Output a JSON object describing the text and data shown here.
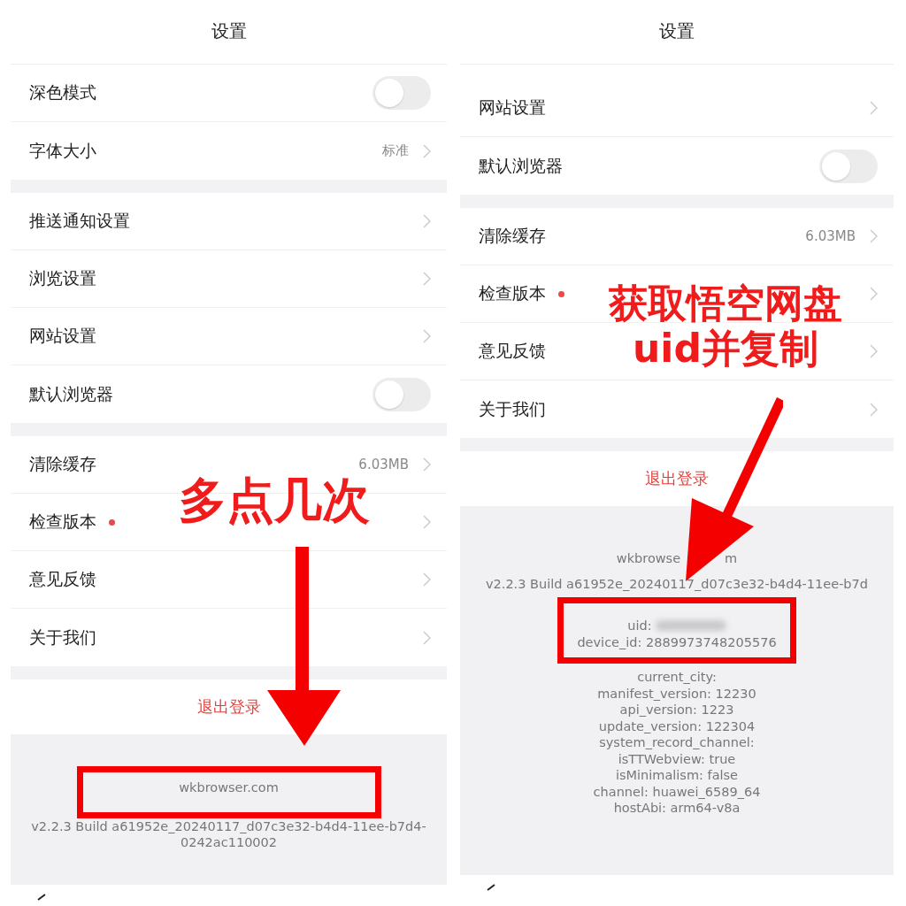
{
  "panels": [
    {
      "title": "设置",
      "groups": [
        [
          {
            "label": "深色模式",
            "kind": "toggle",
            "on": false
          },
          {
            "label": "字体大小",
            "kind": "link",
            "value": "标准"
          }
        ],
        [
          {
            "label": "推送通知设置",
            "kind": "link"
          },
          {
            "label": "浏览设置",
            "kind": "link"
          },
          {
            "label": "网站设置",
            "kind": "link"
          },
          {
            "label": "默认浏览器",
            "kind": "toggle",
            "on": false
          }
        ],
        [
          {
            "label": "清除缓存",
            "kind": "link",
            "value": "6.03MB"
          },
          {
            "label": "检查版本",
            "kind": "link",
            "badge": true
          },
          {
            "label": "意见反馈",
            "kind": "link"
          },
          {
            "label": "关于我们",
            "kind": "link"
          }
        ]
      ],
      "logout": "退出登录",
      "footer": [
        {
          "kind": "text",
          "text": "wkbrowser.com",
          "highlighted": true
        },
        {
          "kind": "text",
          "text": "v2.2.3 Build a61952e_20240117_d07c3e32-b4d4-11ee-b7d4-0242ac110002",
          "highlighted": false
        }
      ],
      "annotation": {
        "kind": "down",
        "caption": [
          "多点几次"
        ]
      }
    },
    {
      "title": "设置",
      "groups": [
        [
          {
            "label": "网站设置",
            "kind": "link"
          },
          {
            "label": "默认浏览器",
            "kind": "toggle",
            "on": false
          }
        ],
        [
          {
            "label": "清除缓存",
            "kind": "link",
            "value": "6.03MB"
          },
          {
            "label": "检查版本",
            "kind": "link",
            "badge": true
          },
          {
            "label": "意见反馈",
            "kind": "link"
          },
          {
            "label": "关于我们",
            "kind": "link"
          }
        ]
      ],
      "logout": "退出登录",
      "footer": [
        {
          "kind": "split",
          "parts": [
            "wkbrowse",
            "m"
          ],
          "highlighted": false
        },
        {
          "kind": "text",
          "text": "v2.2.3 Build a61952e_20240117_d07c3e32-b4d4-11ee-b7d",
          "highlighted": false
        },
        {
          "kind": "blurred",
          "text": "uid:",
          "highlighted": true
        },
        {
          "kind": "text",
          "text": "device_id: 2889973748205576",
          "highlighted": true
        },
        {
          "kind": "text",
          "text": "current_city:",
          "highlighted": false
        },
        {
          "kind": "text",
          "text": "manifest_version: 12230",
          "highlighted": false
        },
        {
          "kind": "text",
          "text": "api_version: 1223",
          "highlighted": false
        },
        {
          "kind": "text",
          "text": "update_version: 122304",
          "highlighted": false
        },
        {
          "kind": "text",
          "text": "system_record_channel:",
          "highlighted": false
        },
        {
          "kind": "text",
          "text": "isTTWebview: true",
          "highlighted": false
        },
        {
          "kind": "text",
          "text": "isMinimalism: false",
          "highlighted": false
        },
        {
          "kind": "text",
          "text": "channel: huawei_6589_64",
          "highlighted": false
        },
        {
          "kind": "text",
          "text": "hostAbi: arm64-v8a",
          "highlighted": false
        }
      ],
      "annotation": {
        "kind": "diagonal",
        "caption": [
          "获取悟空网盘",
          "uid并复制"
        ]
      }
    }
  ]
}
